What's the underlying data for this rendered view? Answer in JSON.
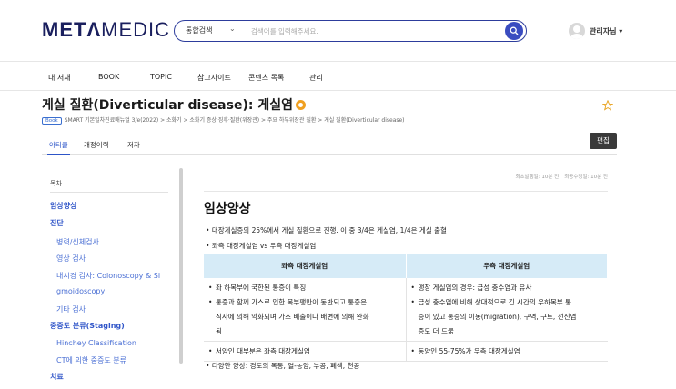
{
  "header": {
    "logo_bold": "METΛ",
    "logo_light": "MEDIC",
    "search": {
      "scope": "통합검색",
      "placeholder": "검색어를 입력해주세요."
    },
    "user": {
      "name": "관리자님 ▾"
    }
  },
  "nav": {
    "items": [
      "내 서재",
      "BOOK",
      "TOPIC",
      "참고사이트",
      "콘텐츠 목록",
      "관리"
    ]
  },
  "article": {
    "title": "게실 질환(Diverticular disease): 게실염",
    "book_badge": "Book",
    "breadcrumb": "SMART 기본일차진료매뉴얼 3/e(2022) > 소화기 > 소화기 증상·징후·질환(위장관) > 주요 하부위장관 질환 > 게실 질환(Diverticular disease)",
    "tabs": [
      "아티클",
      "개정이력",
      "저자"
    ],
    "edit_label": "편집",
    "dates": {
      "created": "최초발행일: 10분 전",
      "modified": "최종수정일: 10분 전"
    }
  },
  "toc": {
    "heading": "목차",
    "items": [
      {
        "label": "임상양상",
        "level": 1
      },
      {
        "label": "진단",
        "level": 1
      },
      {
        "label": "병력/신체검사",
        "level": 2
      },
      {
        "label": "영상 검사",
        "level": 2
      },
      {
        "label": "내시경 검사: Colonoscopy & Si",
        "level": 2
      },
      {
        "label": "gmoidoscopy",
        "level": 2
      },
      {
        "label": "기타 검사",
        "level": 2
      },
      {
        "label": "중증도 분류(Staging)",
        "level": 1
      },
      {
        "label": "Hinchey Classification",
        "level": 2
      },
      {
        "label": "CT에 의한 중증도 분류",
        "level": 2
      },
      {
        "label": "치료",
        "level": 1
      }
    ]
  },
  "content": {
    "section_title": "임상양상",
    "bullets_top": [
      "대장게실증의 25%에서 게실 질환으로 진행. 이 중 3/4은 게실염, 1/4은 게실 출혈",
      "좌측 대장게실염 vs 우측 대장게실염"
    ],
    "table": {
      "headers": [
        "좌측 대장게실염",
        "우측 대장게실염"
      ],
      "rows": [
        {
          "left": [
            "좌 하복부에 국한된 통증이 특징",
            "통증과 함께 가스로 인한 복부팽만이 동반되고 통증은",
            "식사에 의해 악화되며 가스 배출이나 배변에 의해 완화",
            "됨"
          ],
          "right": [
            "맹장 게실염의 경우: 급성 충수염과 유사",
            "급성 충수염에 비해 상대적으로 긴 시간의 우하복부 통",
            "증이 있고 통증의 이동(migration), 구역, 구토, 전신염",
            "증도 더 드묾"
          ]
        },
        {
          "left": [
            "서양인 대부분은 좌측 대장게실염"
          ],
          "right": [
            "동양인 55-75%가 우측 대장게실염"
          ]
        }
      ]
    },
    "bullet_bottom": "다양한 양상: 경도의 복통, 열-농양, 누공, 폐색, 천공"
  },
  "colors": {
    "brand": "#1a1f5e",
    "accent": "#3a4cc0",
    "link": "#3257c9",
    "table_header": "#d6ebf7"
  }
}
